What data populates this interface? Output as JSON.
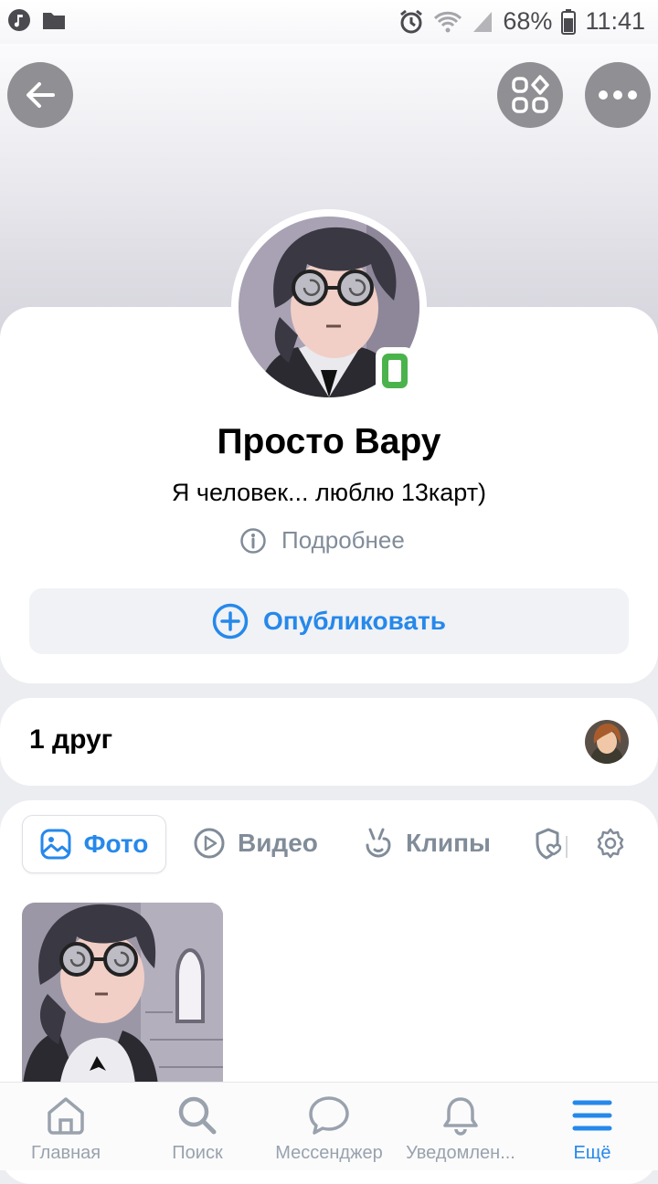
{
  "status_bar": {
    "battery": "68%",
    "time": "11:41"
  },
  "profile": {
    "name": "Просто Вару",
    "status": "Я человек... люблю 13карт)",
    "more_info": "Подробнее",
    "publish_label": "Опубликовать"
  },
  "friends": {
    "label": "1 друг"
  },
  "media_tabs": [
    {
      "label": "Фото",
      "icon": "photo-icon",
      "active": true
    },
    {
      "label": "Видео",
      "icon": "video-icon",
      "active": false
    },
    {
      "label": "Клипы",
      "icon": "clips-icon",
      "active": false
    }
  ],
  "bottom_nav": [
    {
      "label": "Главная",
      "icon": "home-icon",
      "active": false
    },
    {
      "label": "Поиск",
      "icon": "search-icon",
      "active": false
    },
    {
      "label": "Мессенджер",
      "icon": "messenger-icon",
      "active": false
    },
    {
      "label": "Уведомлен...",
      "icon": "bell-icon",
      "active": false
    },
    {
      "label": "Ещё",
      "icon": "menu-icon",
      "active": true
    }
  ],
  "colors": {
    "accent": "#2688eb",
    "secondary_text": "#818c99",
    "online": "#4bb34b",
    "header_button": "#8f8f94"
  }
}
